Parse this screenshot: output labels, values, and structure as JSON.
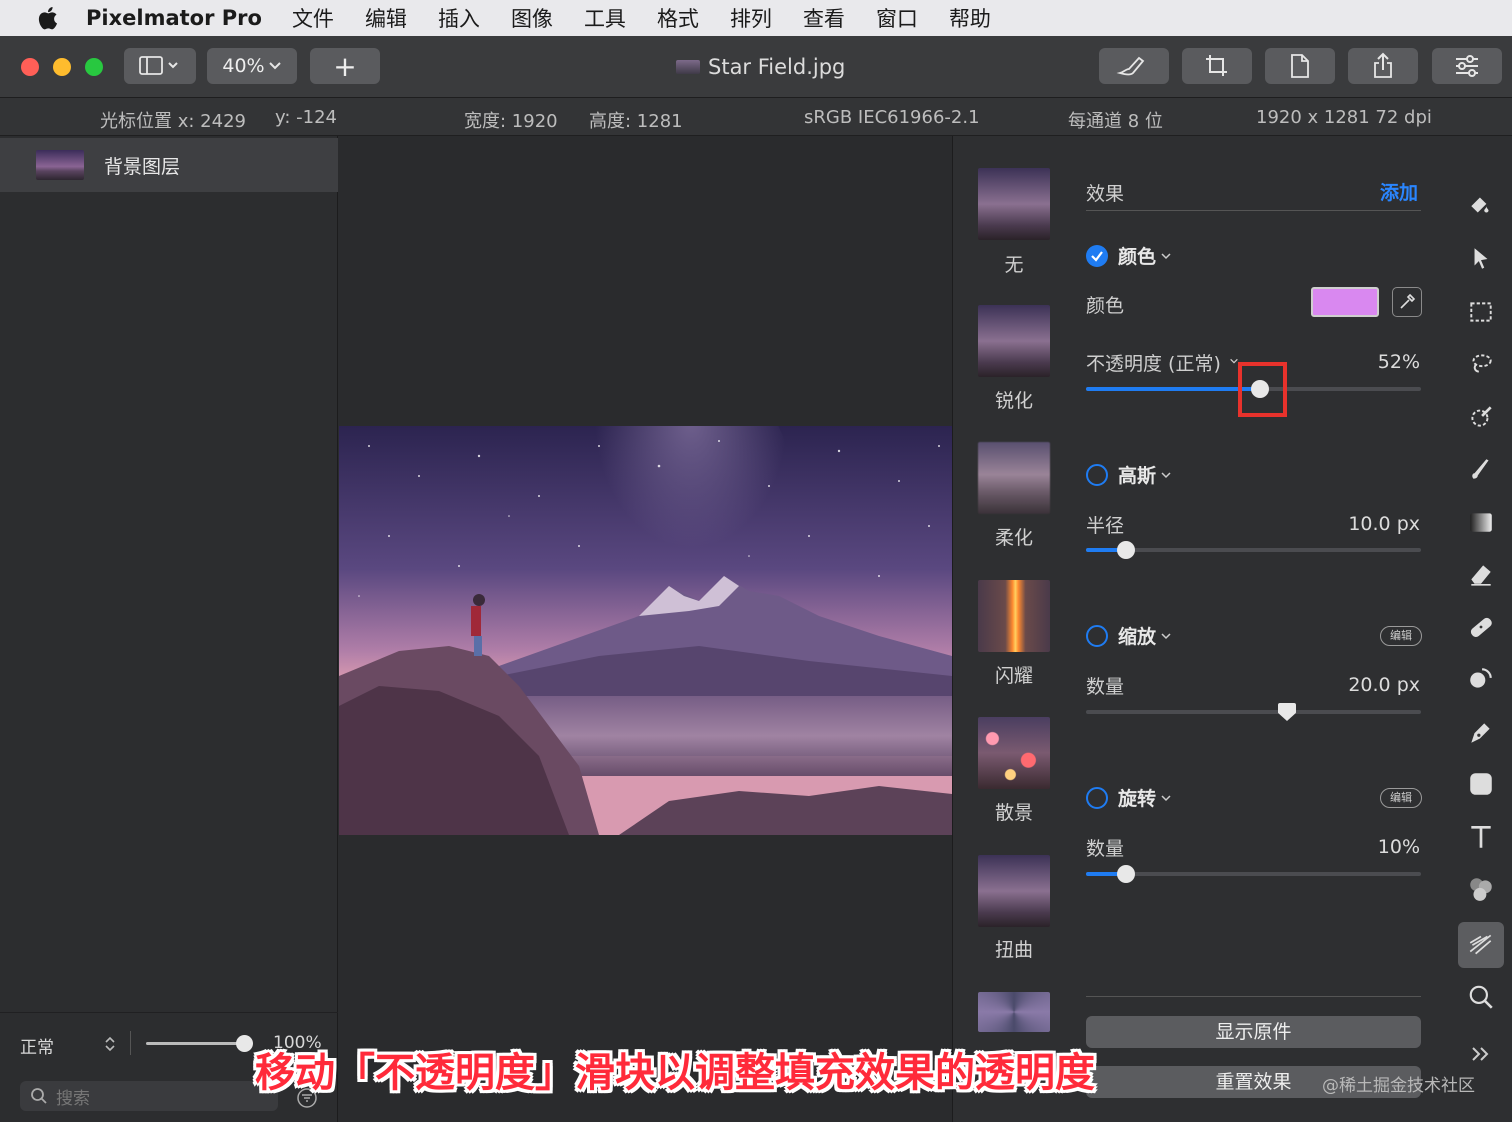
{
  "menubar": {
    "app_name": "Pixelmator Pro",
    "items": [
      "文件",
      "编辑",
      "插入",
      "图像",
      "工具",
      "格式",
      "排列",
      "查看",
      "窗口",
      "帮助"
    ]
  },
  "toolbar": {
    "zoom": "40%",
    "add_label": "+",
    "document_title": "Star Field.jpg"
  },
  "infobar": {
    "cursor_x": "光标位置 x:  2429",
    "cursor_y": "y:  -124",
    "width": "宽度:  1920",
    "height": "高度:  1281",
    "colorspace": "sRGB IEC61966-2.1",
    "bit_depth": "每通道 8 位",
    "resolution": "1920 x 1281 72 dpi"
  },
  "layers": {
    "items": [
      {
        "name": "背景图层"
      }
    ],
    "blend_mode": "正常",
    "opacity": "100%",
    "search_placeholder": "搜索"
  },
  "presets": [
    {
      "label": "无"
    },
    {
      "label": "锐化"
    },
    {
      "label": "柔化"
    },
    {
      "label": "闪耀"
    },
    {
      "label": "散景"
    },
    {
      "label": "扭曲"
    }
  ],
  "effects": {
    "header": "效果",
    "add_label": "添加",
    "color_section": {
      "title": "颜色",
      "enabled": true,
      "color_label": "颜色",
      "swatch_color": "#d988f0",
      "opacity_label": "不透明度 (正常)",
      "opacity_value": "52%",
      "opacity_fraction": 0.52
    },
    "gauss_section": {
      "title": "高斯",
      "enabled": false,
      "radius_label": "半径",
      "radius_value": "10.0 px",
      "radius_fraction": 0.12
    },
    "zoom_section": {
      "title": "缩放",
      "enabled": false,
      "edit_label": "编辑",
      "amount_label": "数量",
      "amount_value": "20.0 px",
      "amount_fraction": 0.6
    },
    "rotate_section": {
      "title": "旋转",
      "enabled": false,
      "edit_label": "编辑",
      "amount_label": "数量",
      "amount_value": "10%",
      "amount_fraction": 0.12
    },
    "show_original_label": "显示原件",
    "reset_label": "重置效果"
  },
  "tools": [
    "paint-bucket-icon",
    "arrow-select-icon",
    "rect-select-icon",
    "lasso-icon",
    "quick-select-icon",
    "brush-icon",
    "gradient-icon",
    "eraser-icon",
    "bandage-icon",
    "clone-icon",
    "pen-icon",
    "shape-icon",
    "text-icon",
    "color-adjust-icon",
    "effects-icon",
    "zoom-icon"
  ],
  "caption": "移动「不透明度」滑块以调整填充效果的透明度",
  "watermark": "@稀土掘金技术社区",
  "colors": {
    "accent": "#1f7cf2",
    "highlight_box": "#e8322c"
  }
}
